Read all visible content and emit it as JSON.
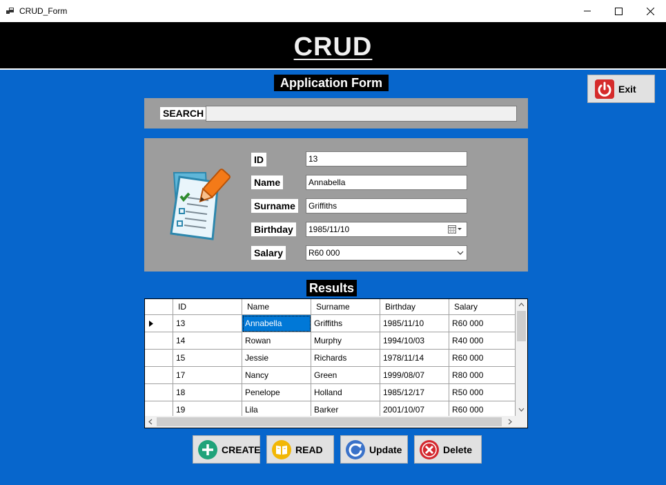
{
  "window": {
    "title": "CRUD_Form"
  },
  "header": {
    "title": "CRUD"
  },
  "form": {
    "title": "Application Form"
  },
  "exit": {
    "label": "Exit"
  },
  "search": {
    "label": "SEARCH",
    "value": ""
  },
  "fields": {
    "id": {
      "label": "ID",
      "value": "13"
    },
    "name": {
      "label": "Name",
      "value": "Annabella"
    },
    "surname": {
      "label": "Surname",
      "value": "Griffiths"
    },
    "birthday": {
      "label": "Birthday",
      "value": "1985/11/10"
    },
    "salary": {
      "label": "Salary",
      "value": "R60 000"
    }
  },
  "results": {
    "title": "Results",
    "columns": [
      "ID",
      "Name",
      "Surname",
      "Birthday",
      "Salary"
    ],
    "rows": [
      [
        "13",
        "Annabella",
        "Griffiths",
        "1985/11/10",
        "R60 000"
      ],
      [
        "14",
        "Rowan",
        "Murphy",
        "1994/10/03",
        "R40 000"
      ],
      [
        "15",
        "Jessie",
        "Richards",
        "1978/11/14",
        "R60 000"
      ],
      [
        "17",
        "Nancy",
        "Green",
        "1999/08/07",
        "R80 000"
      ],
      [
        "18",
        "Penelope",
        "Holland",
        "1985/12/17",
        "R50 000"
      ],
      [
        "19",
        "Lila",
        "Barker",
        "2001/10/07",
        "R60 000"
      ]
    ]
  },
  "actions": {
    "create": "CREATE",
    "read": "READ",
    "update": "Update",
    "delete": "Delete"
  },
  "colors": {
    "background": "#0766cc",
    "header": "#000000",
    "panel": "#9d9d9d",
    "selection": "#0078d7"
  },
  "icons": {
    "exit": "power-icon",
    "create": "plus-icon",
    "read": "book-icon",
    "update": "refresh-icon",
    "delete": "x-circle-icon",
    "form": "clipboard-pencil-icon"
  }
}
